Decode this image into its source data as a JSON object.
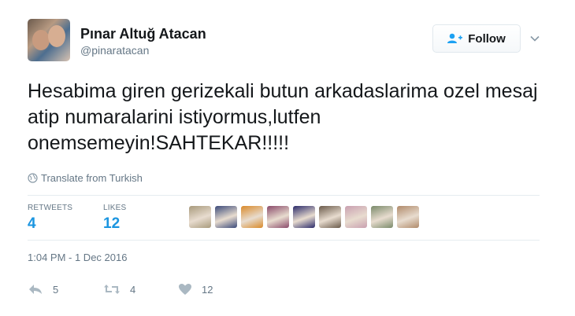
{
  "user": {
    "name": "Pınar Altuğ Atacan",
    "handle": "@pinaratacan"
  },
  "follow_label": "Follow",
  "tweet_text": "Hesabima giren gerizekali butun arkadaslarima ozel mesaj atip numaralarini istiyormus,lutfen onemsemeyin!SAHTEKAR!!!!!",
  "translate_label": "Translate from Turkish",
  "stats": {
    "retweets_label": "RETWEETS",
    "retweets_count": "4",
    "likes_label": "LIKES",
    "likes_count": "12"
  },
  "likers_colors": [
    "#a89a7c",
    "#3b4a7a",
    "#d98a2a",
    "#8a4a6a",
    "#2a2a6a",
    "#6a5a4a",
    "#c9a0b0",
    "#7a8a6a",
    "#b08a6a"
  ],
  "timestamp": "1:04 PM - 1 Dec 2016",
  "actions": {
    "reply_count": "5",
    "retweet_count": "4",
    "like_count": "12"
  },
  "colors": {
    "accent": "#1b95e0",
    "muted": "#657786"
  }
}
